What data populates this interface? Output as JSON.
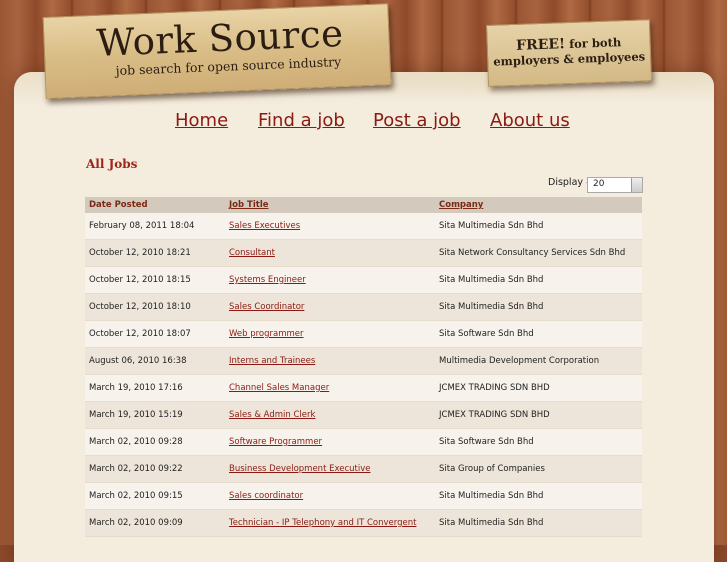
{
  "header": {
    "logo_title": "Work Source",
    "logo_subtitle": "job search for open source industry",
    "free_line1": "FREE!",
    "free_line1_rest": "for both",
    "free_line2": "employers & employees"
  },
  "nav": {
    "home": "Home",
    "find": "Find a job",
    "post": "Post a job",
    "about": "About us"
  },
  "main": {
    "section_title": "All Jobs",
    "display_label": "Display #",
    "display_value": "20",
    "columns": {
      "date": "Date Posted",
      "title": "Job Title",
      "company": "Company"
    },
    "rows": [
      {
        "date": "February 08, 2011  18:04",
        "title": "Sales Executives",
        "company": "Sita Multimedia Sdn Bhd"
      },
      {
        "date": "October 12, 2010  18:21",
        "title": "Consultant",
        "company": "Sita Network Consultancy Services Sdn Bhd"
      },
      {
        "date": "October 12, 2010  18:15",
        "title": "Systems Engineer",
        "company": "Sita Multimedia Sdn Bhd"
      },
      {
        "date": "October 12, 2010  18:10",
        "title": "Sales Coordinator",
        "company": "Sita Multimedia Sdn Bhd"
      },
      {
        "date": "October 12, 2010  18:07",
        "title": "Web programmer",
        "company": "Sita Software Sdn Bhd"
      },
      {
        "date": "August 06, 2010  16:38",
        "title": "Interns and Trainees",
        "company": "Multimedia Development Corporation"
      },
      {
        "date": "March 19, 2010  17:16",
        "title": "Channel Sales Manager",
        "company": "JCMEX TRADING SDN BHD"
      },
      {
        "date": "March 19, 2010  15:19",
        "title": "Sales & Admin Clerk",
        "company": "JCMEX TRADING SDN BHD"
      },
      {
        "date": "March 02, 2010  09:28",
        "title": "Software Programmer",
        "company": "Sita Software Sdn Bhd"
      },
      {
        "date": "March 02, 2010  09:22",
        "title": "Business Development Executive",
        "company": "Sita Group of Companies"
      },
      {
        "date": "March 02, 2010  09:15",
        "title": "Sales coordinator",
        "company": "Sita Multimedia Sdn Bhd"
      },
      {
        "date": "March 02, 2010  09:09",
        "title": "Technician - IP Telephony and IT Convergent",
        "company": "Sita Multimedia Sdn Bhd"
      }
    ]
  },
  "colors": {
    "link": "#8b1a12",
    "heading": "#a0241a",
    "table_header_bg": "#d3cabd"
  }
}
